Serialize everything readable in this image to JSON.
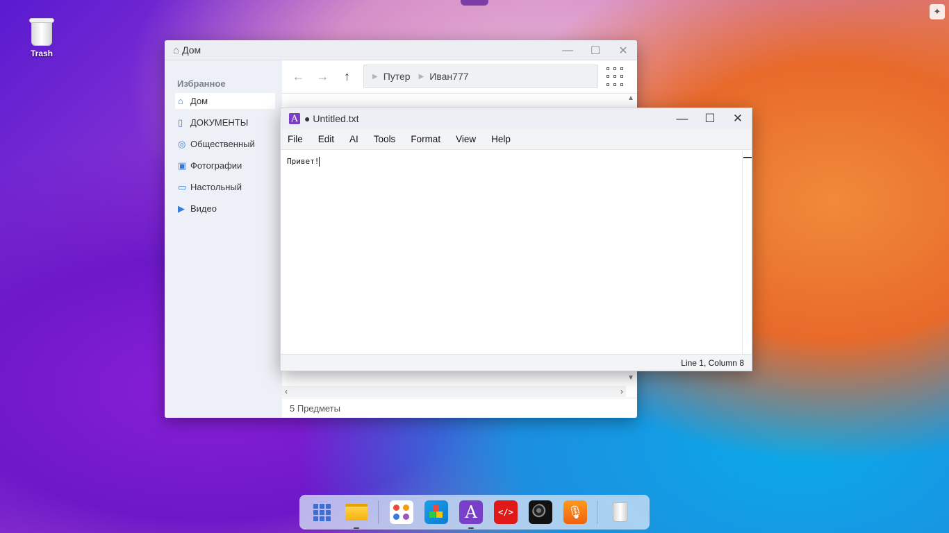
{
  "desktop": {
    "trash_label": "Trash"
  },
  "file_manager": {
    "title": "Дом",
    "sidebar_section": "Избранное",
    "sidebar_items": [
      {
        "label": "Дом",
        "icon": "home-icon"
      },
      {
        "label": "ДОКУМЕНТЫ",
        "icon": "document-icon"
      },
      {
        "label": "Общественный",
        "icon": "globe-icon"
      },
      {
        "label": "Фотографии",
        "icon": "image-icon"
      },
      {
        "label": "Настольный",
        "icon": "desktop-icon"
      },
      {
        "label": "Видео",
        "icon": "video-icon"
      }
    ],
    "breadcrumb": [
      "Путер",
      "Иван777"
    ],
    "status": "5 Предметы"
  },
  "editor": {
    "title": "● Untitled.txt",
    "menu": [
      "File",
      "Edit",
      "AI",
      "Tools",
      "Format",
      "View",
      "Help"
    ],
    "content": "Привет!",
    "status": "Line 1, Column 8"
  },
  "dock": {
    "items": [
      "apps-grid-icon",
      "folder-icon",
      "app-store-icon",
      "cubes-icon",
      "text-editor-icon",
      "dev-center-icon",
      "camera-icon",
      "recorder-icon",
      "trash-icon"
    ]
  },
  "colors": {
    "accent": "#3a7ad8",
    "editor_brand": "#7a3fc8"
  }
}
